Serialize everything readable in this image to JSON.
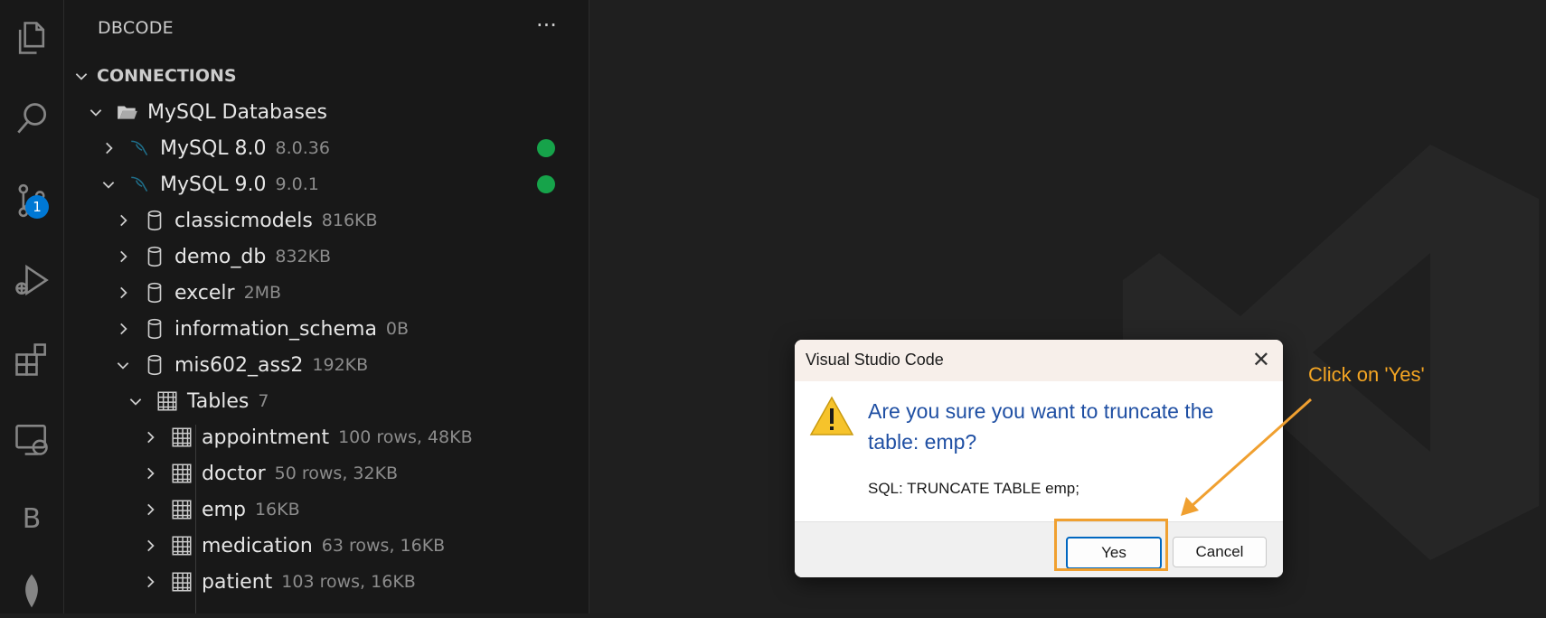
{
  "sidebar": {
    "title": "DBCODE",
    "more_label": "···",
    "section_label": "CONNECTIONS",
    "group_label": "MySQL Databases",
    "connections": [
      {
        "name": "MySQL 8.0",
        "version": "8.0.36",
        "status_color": "#16a34a"
      },
      {
        "name": "MySQL 9.0",
        "version": "9.0.1",
        "status_color": "#16a34a"
      }
    ],
    "databases": [
      {
        "name": "classicmodels",
        "size": "816KB"
      },
      {
        "name": "demo_db",
        "size": "832KB"
      },
      {
        "name": "excelr",
        "size": "2MB"
      },
      {
        "name": "information_schema",
        "size": "0B"
      },
      {
        "name": "mis602_ass2",
        "size": "192KB"
      }
    ],
    "tables_label": "Tables",
    "tables_count": "7",
    "tables": [
      {
        "name": "appointment",
        "info": "100 rows, 48KB"
      },
      {
        "name": "doctor",
        "info": "50 rows, 32KB"
      },
      {
        "name": "emp",
        "info": "16KB"
      },
      {
        "name": "medication",
        "info": "63 rows, 16KB"
      },
      {
        "name": "patient",
        "info": "103 rows, 16KB"
      }
    ]
  },
  "activity_bar": {
    "scm_badge": "1",
    "b_label": "B",
    "icons": [
      "explorer-icon",
      "search-icon",
      "source-control-icon",
      "run-debug-icon",
      "extensions-icon",
      "remote-explorer-icon",
      "b-icon",
      "leaf-icon"
    ]
  },
  "dialog": {
    "title": "Visual Studio Code",
    "close_label": "✕",
    "message": "Are you sure you want to truncate the table: emp?",
    "sql": "SQL: TRUNCATE TABLE emp;",
    "yes_label": "Yes",
    "cancel_label": "Cancel"
  },
  "annotation": {
    "text": "Click on 'Yes'",
    "color": "#f5a623"
  }
}
